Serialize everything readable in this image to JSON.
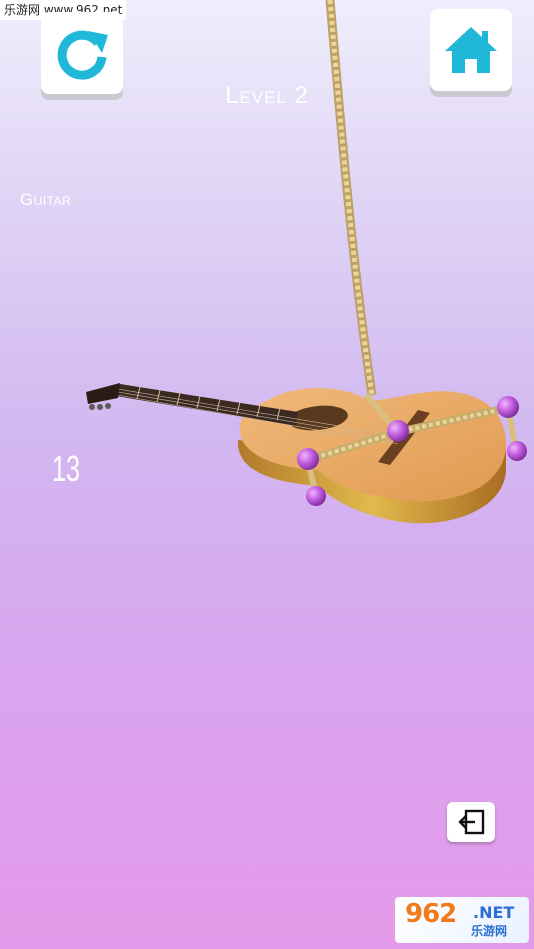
{
  "watermark": {
    "text": "乐游网 www.962.net"
  },
  "hud": {
    "level_label": "Level 2",
    "item_name": "Guitar",
    "counter": "13"
  },
  "buttons": {
    "restart_icon": "refresh-icon",
    "home_icon": "home-icon",
    "exit_icon": "exit-icon"
  },
  "logo": {
    "big": "962",
    "net": ".NET",
    "sub": "乐游网"
  },
  "colors": {
    "accent_cyan": "#1fb8d8",
    "guitar_body": "#e8a860",
    "rope": "#e6cc8e",
    "pin": "#b54fd6"
  }
}
